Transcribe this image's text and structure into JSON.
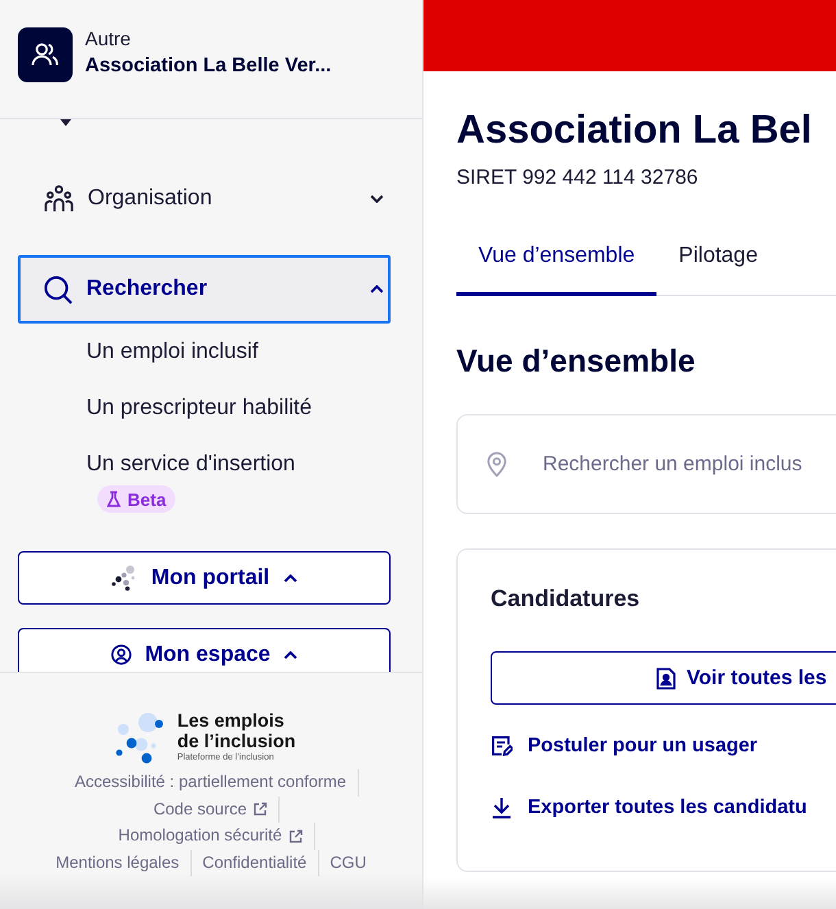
{
  "sidebar": {
    "organization": {
      "type": "Autre",
      "name": "Association La Belle Ver..."
    },
    "nav": [
      {
        "label": "Organisation",
        "kind": "organisation",
        "selected": false,
        "expanded": false
      },
      {
        "label": "Rechercher",
        "kind": "search",
        "selected": true,
        "expanded": true,
        "children": [
          {
            "label": "Un emploi inclusif"
          },
          {
            "label": "Un prescripteur habilité"
          },
          {
            "label": "Un service d'insertion",
            "badge": "Beta"
          }
        ]
      }
    ],
    "menus": [
      {
        "label": "Mon portail",
        "kind": "portal",
        "expanded": true
      },
      {
        "label": "Mon espace",
        "kind": "account",
        "expanded": true
      }
    ]
  },
  "footer": {
    "logo": {
      "lines": [
        "Les emplois",
        "de l’inclusion"
      ],
      "tagline": "Plateforme de l’inclusion"
    },
    "links": [
      {
        "label": "Accessibilité : partiellement conforme",
        "external": false
      },
      {
        "label": "Code source",
        "external": true
      },
      {
        "label": "Homologation sécurité",
        "external": true
      },
      {
        "label": "Mentions légales",
        "external": false
      },
      {
        "label": "Confidentialité",
        "external": false
      },
      {
        "label": "CGU",
        "external": false
      }
    ]
  },
  "main": {
    "title": "Association La Bel",
    "siret": "SIRET 992 442 114 32786",
    "tabs": [
      {
        "label": "Vue d’ensemble",
        "selected": true
      },
      {
        "label": "Pilotage",
        "selected": false
      }
    ],
    "section_title": "Vue d’ensemble",
    "search": {
      "placeholder": "Rechercher un emploi inclus"
    },
    "applications": {
      "title": "Candidatures",
      "button": "Voir toutes les",
      "links": [
        {
          "label": "Postuler pour un usager",
          "kind": "apply"
        },
        {
          "label": "Exporter toutes les candidatu",
          "kind": "export"
        }
      ]
    }
  }
}
